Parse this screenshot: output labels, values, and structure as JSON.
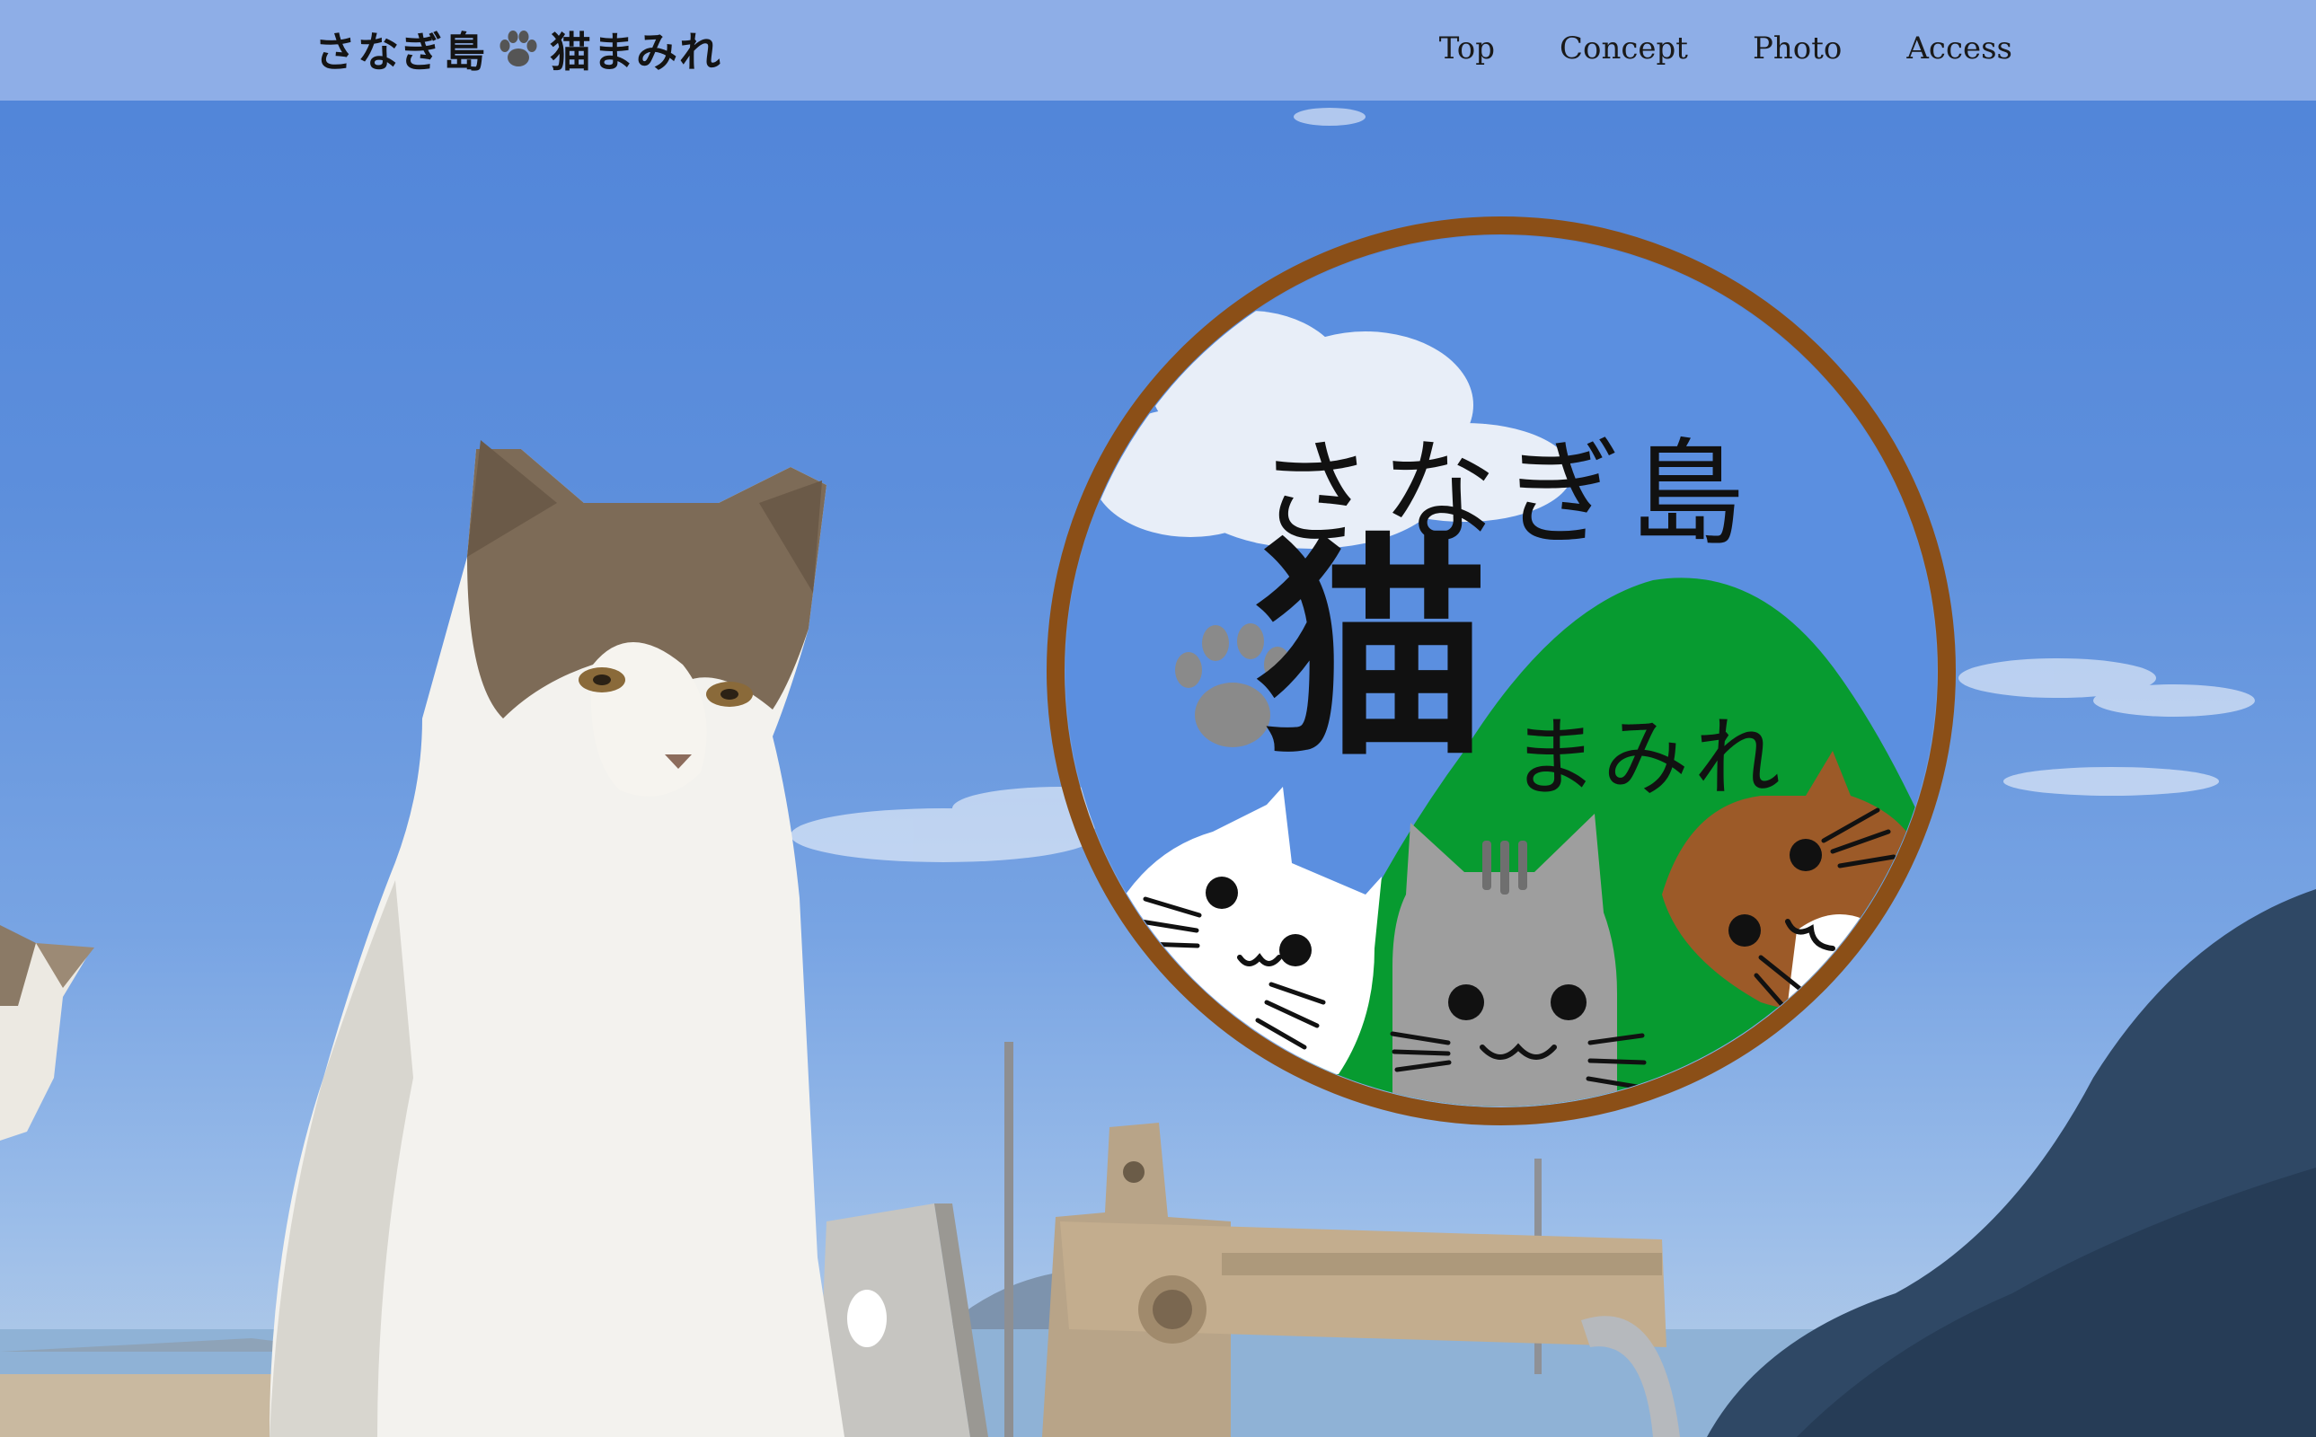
{
  "site": {
    "brand_text_1": "さなぎ島",
    "brand_text_2": "猫まみれ",
    "brand_icon": "paw-icon"
  },
  "nav": {
    "items": [
      {
        "label": "Top"
      },
      {
        "label": "Concept"
      },
      {
        "label": "Photo"
      },
      {
        "label": "Access"
      }
    ]
  },
  "hero": {
    "emblem": {
      "title": "さなぎ島",
      "big_char": "猫",
      "subtitle": "まみれ",
      "ring_color": "#8b4f17",
      "mountain_color": "#079b30",
      "inner_sky_color": "#5b8fe0"
    }
  },
  "colors": {
    "header_bg": "#94b2e8",
    "sky": "#5d8fdc",
    "text": "#141414"
  }
}
